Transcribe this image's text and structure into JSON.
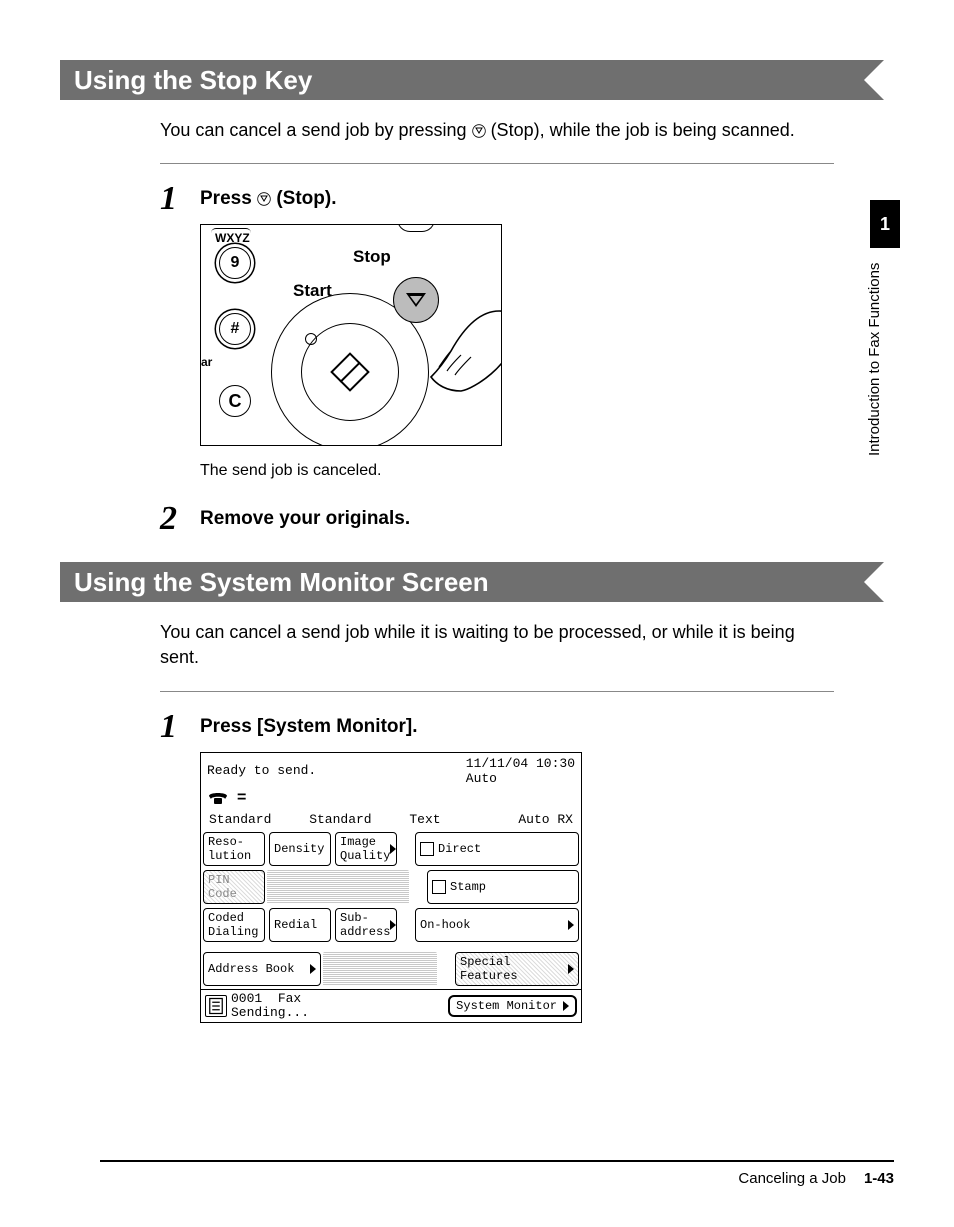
{
  "header1": "Using the Stop Key",
  "intro1_a": "You can cancel a send job by pressing ",
  "intro1_b": " (Stop), while the job is being scanned.",
  "step1": {
    "num": "1",
    "head_a": "Press ",
    "head_b": " (Stop).",
    "note": "The send job is canceled.",
    "labels": {
      "wxyz": "WXYZ",
      "k9": "9",
      "khash": "#",
      "kC": "C",
      "ar": "ar",
      "stop": "Stop",
      "start": "Start"
    }
  },
  "step2": {
    "num": "2",
    "head": "Remove your originals."
  },
  "header2": "Using the System Monitor Screen",
  "intro2": "You can cancel a send job while it is waiting to be processed, or while it is being sent.",
  "step3": {
    "num": "1",
    "head": "Press [System Monitor].",
    "lcd": {
      "ready": "Ready to send.",
      "datetime": "11/11/04 10:30",
      "auto": "Auto",
      "eq": "=",
      "row_status": [
        "Standard",
        "Standard",
        "Text",
        "Auto RX"
      ],
      "row1": {
        "reso": "Reso-\nlution",
        "density": "Density",
        "iq": "Image\nQuality",
        "direct": "Direct"
      },
      "pin": "PIN Code",
      "stamp": "Stamp",
      "row3": {
        "coded": "Coded\nDialing",
        "redial": "Redial",
        "sub": "Sub-\naddress",
        "onhook": "On-hook"
      },
      "address_book": "Address Book",
      "special": "Special\nFeatures",
      "job_id": "0001",
      "job_type": "Fax",
      "job_state": "Sending...",
      "sysmon": "System Monitor"
    }
  },
  "sidebar": {
    "tab": "1",
    "label": "Introduction to Fax Functions"
  },
  "footer": {
    "title": "Canceling a Job",
    "page": "1-43"
  }
}
